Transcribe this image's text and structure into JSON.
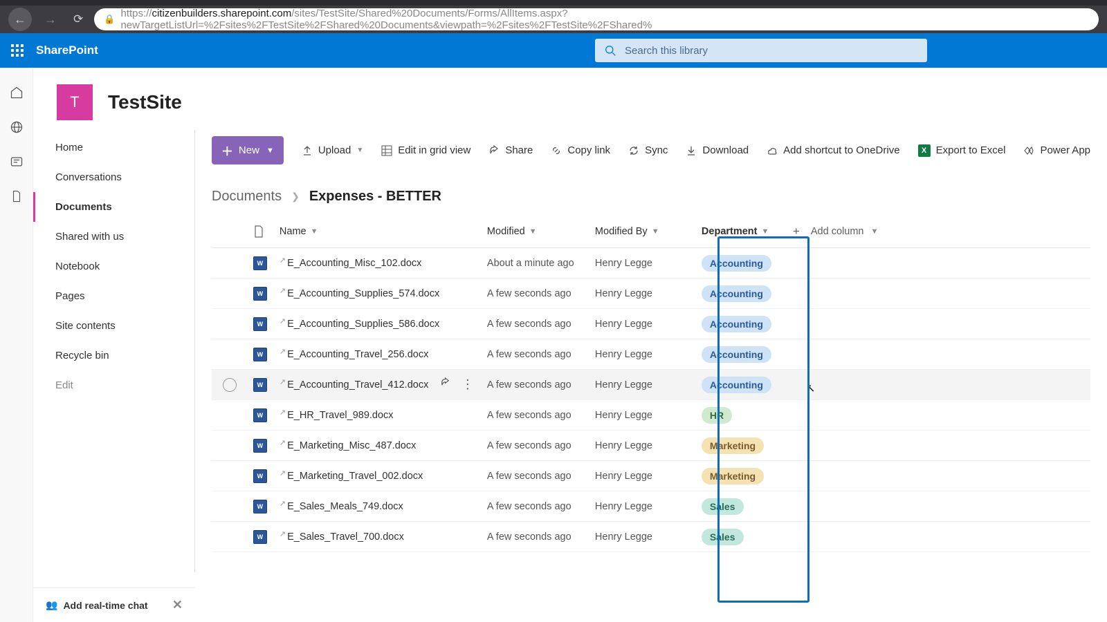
{
  "url": {
    "host": "citizenbuilders.sharepoint.com",
    "path": "/sites/TestSite/Shared%20Documents/Forms/AllItems.aspx?newTargetListUrl=%2Fsites%2FTestSite%2FShared%20Documents&viewpath=%2Fsites%2FTestSite%2FShared%"
  },
  "brand": "SharePoint",
  "search": {
    "placeholder": "Search this library"
  },
  "site": {
    "initial": "T",
    "title": "TestSite"
  },
  "nav": {
    "items": [
      "Home",
      "Conversations",
      "Documents",
      "Shared with us",
      "Notebook",
      "Pages",
      "Site contents",
      "Recycle bin",
      "Edit"
    ],
    "active_index": 2
  },
  "chat_promo": "Add real-time chat",
  "cmd": {
    "new": "New",
    "upload": "Upload",
    "grid": "Edit in grid view",
    "share": "Share",
    "copy": "Copy link",
    "sync": "Sync",
    "download": "Download",
    "shortcut": "Add shortcut to OneDrive",
    "excel": "Export to Excel",
    "power": "Power App"
  },
  "crumbs": {
    "root": "Documents",
    "current": "Expenses - BETTER"
  },
  "cols": {
    "name": "Name",
    "mod": "Modified",
    "by": "Modified By",
    "dept": "Department",
    "add": "Add column"
  },
  "rows": [
    {
      "name": "E_Accounting_Misc_102.docx",
      "mod": "About a minute ago",
      "by": "Henry Legge",
      "dept": "Accounting",
      "pill": "acct"
    },
    {
      "name": "E_Accounting_Supplies_574.docx",
      "mod": "A few seconds ago",
      "by": "Henry Legge",
      "dept": "Accounting",
      "pill": "acct"
    },
    {
      "name": "E_Accounting_Supplies_586.docx",
      "mod": "A few seconds ago",
      "by": "Henry Legge",
      "dept": "Accounting",
      "pill": "acct"
    },
    {
      "name": "E_Accounting_Travel_256.docx",
      "mod": "A few seconds ago",
      "by": "Henry Legge",
      "dept": "Accounting",
      "pill": "acct"
    },
    {
      "name": "E_Accounting_Travel_412.docx",
      "mod": "A few seconds ago",
      "by": "Henry Legge",
      "dept": "Accounting",
      "pill": "acct",
      "hover": true
    },
    {
      "name": "E_HR_Travel_989.docx",
      "mod": "A few seconds ago",
      "by": "Henry Legge",
      "dept": "HR",
      "pill": "hr"
    },
    {
      "name": "E_Marketing_Misc_487.docx",
      "mod": "A few seconds ago",
      "by": "Henry Legge",
      "dept": "Marketing",
      "pill": "mkt"
    },
    {
      "name": "E_Marketing_Travel_002.docx",
      "mod": "A few seconds ago",
      "by": "Henry Legge",
      "dept": "Marketing",
      "pill": "mkt"
    },
    {
      "name": "E_Sales_Meals_749.docx",
      "mod": "A few seconds ago",
      "by": "Henry Legge",
      "dept": "Sales",
      "pill": "sales"
    },
    {
      "name": "E_Sales_Travel_700.docx",
      "mod": "A few seconds ago",
      "by": "Henry Legge",
      "dept": "Sales",
      "pill": "sales"
    }
  ]
}
